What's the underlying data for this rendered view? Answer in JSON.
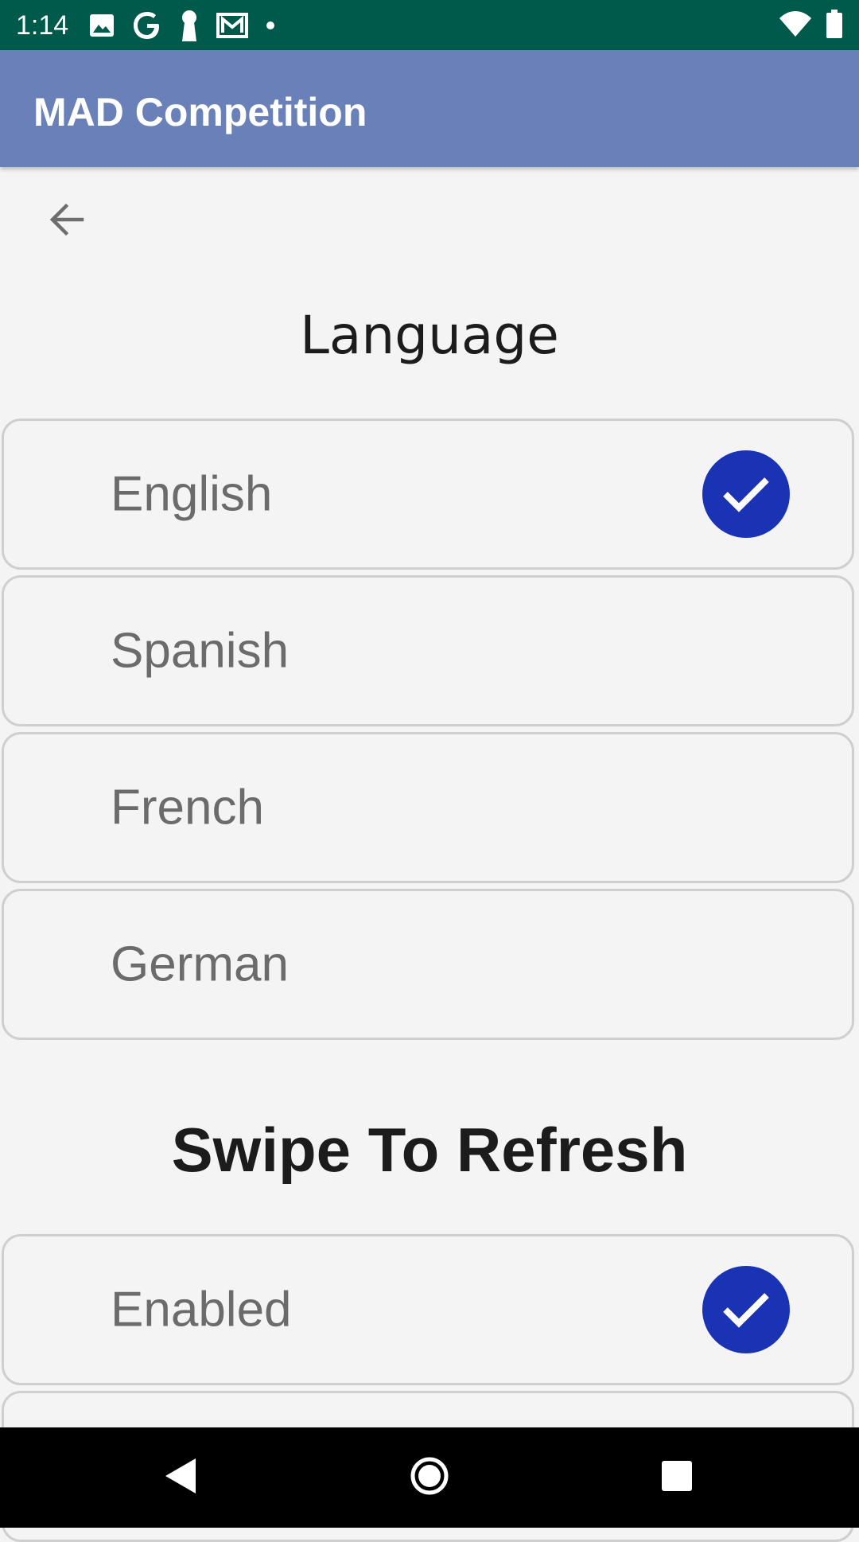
{
  "status_bar": {
    "time": "1:14",
    "icons": [
      "image-icon",
      "google-icon",
      "keyhole-icon",
      "gmail-icon",
      "dot-icon",
      "wifi-icon",
      "battery-icon"
    ]
  },
  "app_bar": {
    "title": "MAD Competition"
  },
  "back_icon": "arrow-left-icon",
  "language": {
    "title": "Language",
    "options": [
      {
        "label": "English",
        "selected": true
      },
      {
        "label": "Spanish",
        "selected": false
      },
      {
        "label": "French",
        "selected": false
      },
      {
        "label": "German",
        "selected": false
      }
    ]
  },
  "swipe": {
    "title": "Swipe To Refresh",
    "options": [
      {
        "label": "Enabled",
        "selected": true
      }
    ]
  },
  "colors": {
    "status_bar": "#005a4c",
    "app_bar": "#6a80b8",
    "check": "#1a33b5",
    "background": "#f4f4f4"
  },
  "nav_bar": {
    "buttons": [
      "back-triangle-icon",
      "home-circle-icon",
      "recents-square-icon"
    ]
  }
}
